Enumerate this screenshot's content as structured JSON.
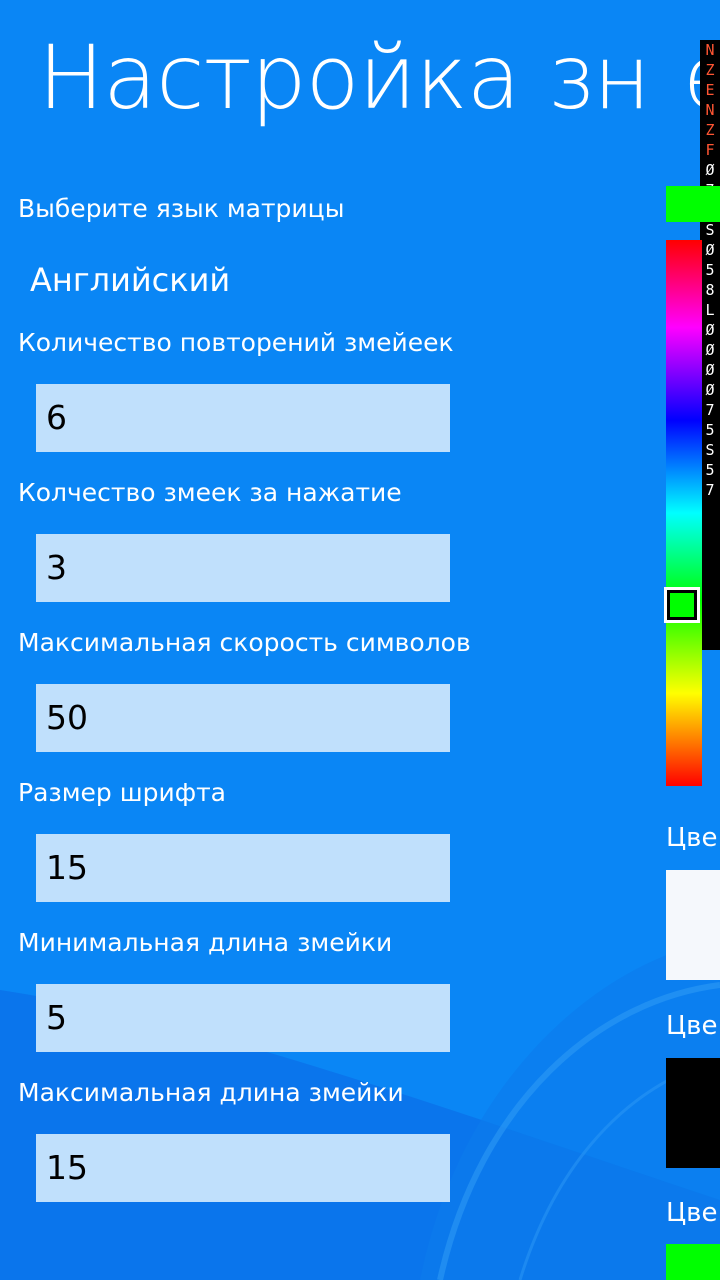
{
  "page": {
    "title": "Настройка знач",
    "title_edge": "е"
  },
  "settings": {
    "language_label": "Выберите язык матрицы",
    "language_value": "Английский",
    "repeat_label": "Количество повторений змейеек",
    "repeat_value": "6",
    "per_tap_label": "Колчество  змеек за нажатие",
    "per_tap_value": "3",
    "max_speed_label": "Максимальная скорость символов",
    "max_speed_value": "50",
    "font_size_label": "Размер шрифта",
    "font_size_value": "15",
    "min_length_label": "Минимальная длина змейки",
    "min_length_value": "5",
    "max_length_label": "Максимальная длина змейки",
    "max_length_value": "15"
  },
  "colors": {
    "label_1": "Цве",
    "label_2": "Цве",
    "label_3": "Цве",
    "swatch_1": "#f5f8fc",
    "swatch_2": "#000000",
    "swatch_3": "#00ff00",
    "preview": "#00ff00"
  },
  "matrix_glyphs": [
    "N",
    "Z",
    "E",
    "",
    "N",
    "Z",
    "F",
    "",
    "Ø",
    "7",
    "9",
    "S",
    "Ø",
    "",
    "5",
    "8",
    "L",
    "",
    "Ø",
    "Ø",
    "Ø",
    "",
    "Ø",
    "7",
    "5",
    "S",
    "5",
    "7"
  ]
}
